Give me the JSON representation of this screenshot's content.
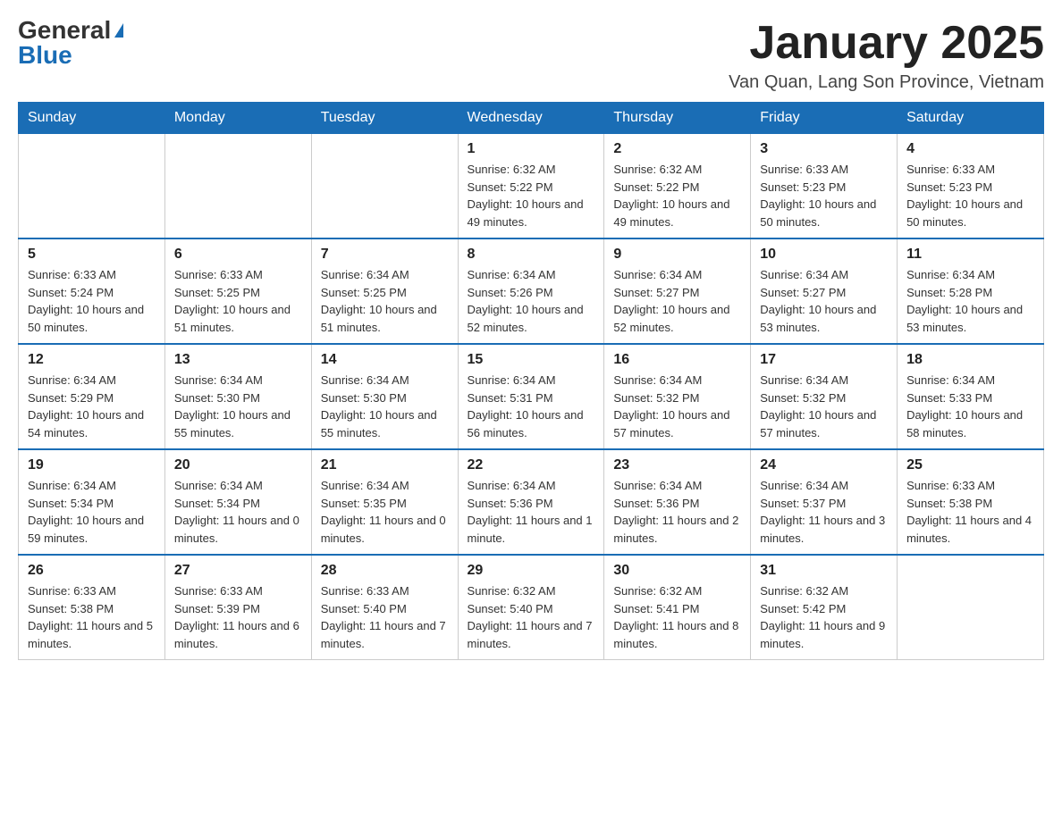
{
  "header": {
    "logo_general": "General",
    "logo_blue": "Blue",
    "month_title": "January 2025",
    "location": "Van Quan, Lang Son Province, Vietnam"
  },
  "weekdays": [
    "Sunday",
    "Monday",
    "Tuesday",
    "Wednesday",
    "Thursday",
    "Friday",
    "Saturday"
  ],
  "weeks": [
    [
      {
        "day": "",
        "info": ""
      },
      {
        "day": "",
        "info": ""
      },
      {
        "day": "",
        "info": ""
      },
      {
        "day": "1",
        "info": "Sunrise: 6:32 AM\nSunset: 5:22 PM\nDaylight: 10 hours and 49 minutes."
      },
      {
        "day": "2",
        "info": "Sunrise: 6:32 AM\nSunset: 5:22 PM\nDaylight: 10 hours and 49 minutes."
      },
      {
        "day": "3",
        "info": "Sunrise: 6:33 AM\nSunset: 5:23 PM\nDaylight: 10 hours and 50 minutes."
      },
      {
        "day": "4",
        "info": "Sunrise: 6:33 AM\nSunset: 5:23 PM\nDaylight: 10 hours and 50 minutes."
      }
    ],
    [
      {
        "day": "5",
        "info": "Sunrise: 6:33 AM\nSunset: 5:24 PM\nDaylight: 10 hours and 50 minutes."
      },
      {
        "day": "6",
        "info": "Sunrise: 6:33 AM\nSunset: 5:25 PM\nDaylight: 10 hours and 51 minutes."
      },
      {
        "day": "7",
        "info": "Sunrise: 6:34 AM\nSunset: 5:25 PM\nDaylight: 10 hours and 51 minutes."
      },
      {
        "day": "8",
        "info": "Sunrise: 6:34 AM\nSunset: 5:26 PM\nDaylight: 10 hours and 52 minutes."
      },
      {
        "day": "9",
        "info": "Sunrise: 6:34 AM\nSunset: 5:27 PM\nDaylight: 10 hours and 52 minutes."
      },
      {
        "day": "10",
        "info": "Sunrise: 6:34 AM\nSunset: 5:27 PM\nDaylight: 10 hours and 53 minutes."
      },
      {
        "day": "11",
        "info": "Sunrise: 6:34 AM\nSunset: 5:28 PM\nDaylight: 10 hours and 53 minutes."
      }
    ],
    [
      {
        "day": "12",
        "info": "Sunrise: 6:34 AM\nSunset: 5:29 PM\nDaylight: 10 hours and 54 minutes."
      },
      {
        "day": "13",
        "info": "Sunrise: 6:34 AM\nSunset: 5:30 PM\nDaylight: 10 hours and 55 minutes."
      },
      {
        "day": "14",
        "info": "Sunrise: 6:34 AM\nSunset: 5:30 PM\nDaylight: 10 hours and 55 minutes."
      },
      {
        "day": "15",
        "info": "Sunrise: 6:34 AM\nSunset: 5:31 PM\nDaylight: 10 hours and 56 minutes."
      },
      {
        "day": "16",
        "info": "Sunrise: 6:34 AM\nSunset: 5:32 PM\nDaylight: 10 hours and 57 minutes."
      },
      {
        "day": "17",
        "info": "Sunrise: 6:34 AM\nSunset: 5:32 PM\nDaylight: 10 hours and 57 minutes."
      },
      {
        "day": "18",
        "info": "Sunrise: 6:34 AM\nSunset: 5:33 PM\nDaylight: 10 hours and 58 minutes."
      }
    ],
    [
      {
        "day": "19",
        "info": "Sunrise: 6:34 AM\nSunset: 5:34 PM\nDaylight: 10 hours and 59 minutes."
      },
      {
        "day": "20",
        "info": "Sunrise: 6:34 AM\nSunset: 5:34 PM\nDaylight: 11 hours and 0 minutes."
      },
      {
        "day": "21",
        "info": "Sunrise: 6:34 AM\nSunset: 5:35 PM\nDaylight: 11 hours and 0 minutes."
      },
      {
        "day": "22",
        "info": "Sunrise: 6:34 AM\nSunset: 5:36 PM\nDaylight: 11 hours and 1 minute."
      },
      {
        "day": "23",
        "info": "Sunrise: 6:34 AM\nSunset: 5:36 PM\nDaylight: 11 hours and 2 minutes."
      },
      {
        "day": "24",
        "info": "Sunrise: 6:34 AM\nSunset: 5:37 PM\nDaylight: 11 hours and 3 minutes."
      },
      {
        "day": "25",
        "info": "Sunrise: 6:33 AM\nSunset: 5:38 PM\nDaylight: 11 hours and 4 minutes."
      }
    ],
    [
      {
        "day": "26",
        "info": "Sunrise: 6:33 AM\nSunset: 5:38 PM\nDaylight: 11 hours and 5 minutes."
      },
      {
        "day": "27",
        "info": "Sunrise: 6:33 AM\nSunset: 5:39 PM\nDaylight: 11 hours and 6 minutes."
      },
      {
        "day": "28",
        "info": "Sunrise: 6:33 AM\nSunset: 5:40 PM\nDaylight: 11 hours and 7 minutes."
      },
      {
        "day": "29",
        "info": "Sunrise: 6:32 AM\nSunset: 5:40 PM\nDaylight: 11 hours and 7 minutes."
      },
      {
        "day": "30",
        "info": "Sunrise: 6:32 AM\nSunset: 5:41 PM\nDaylight: 11 hours and 8 minutes."
      },
      {
        "day": "31",
        "info": "Sunrise: 6:32 AM\nSunset: 5:42 PM\nDaylight: 11 hours and 9 minutes."
      },
      {
        "day": "",
        "info": ""
      }
    ]
  ]
}
